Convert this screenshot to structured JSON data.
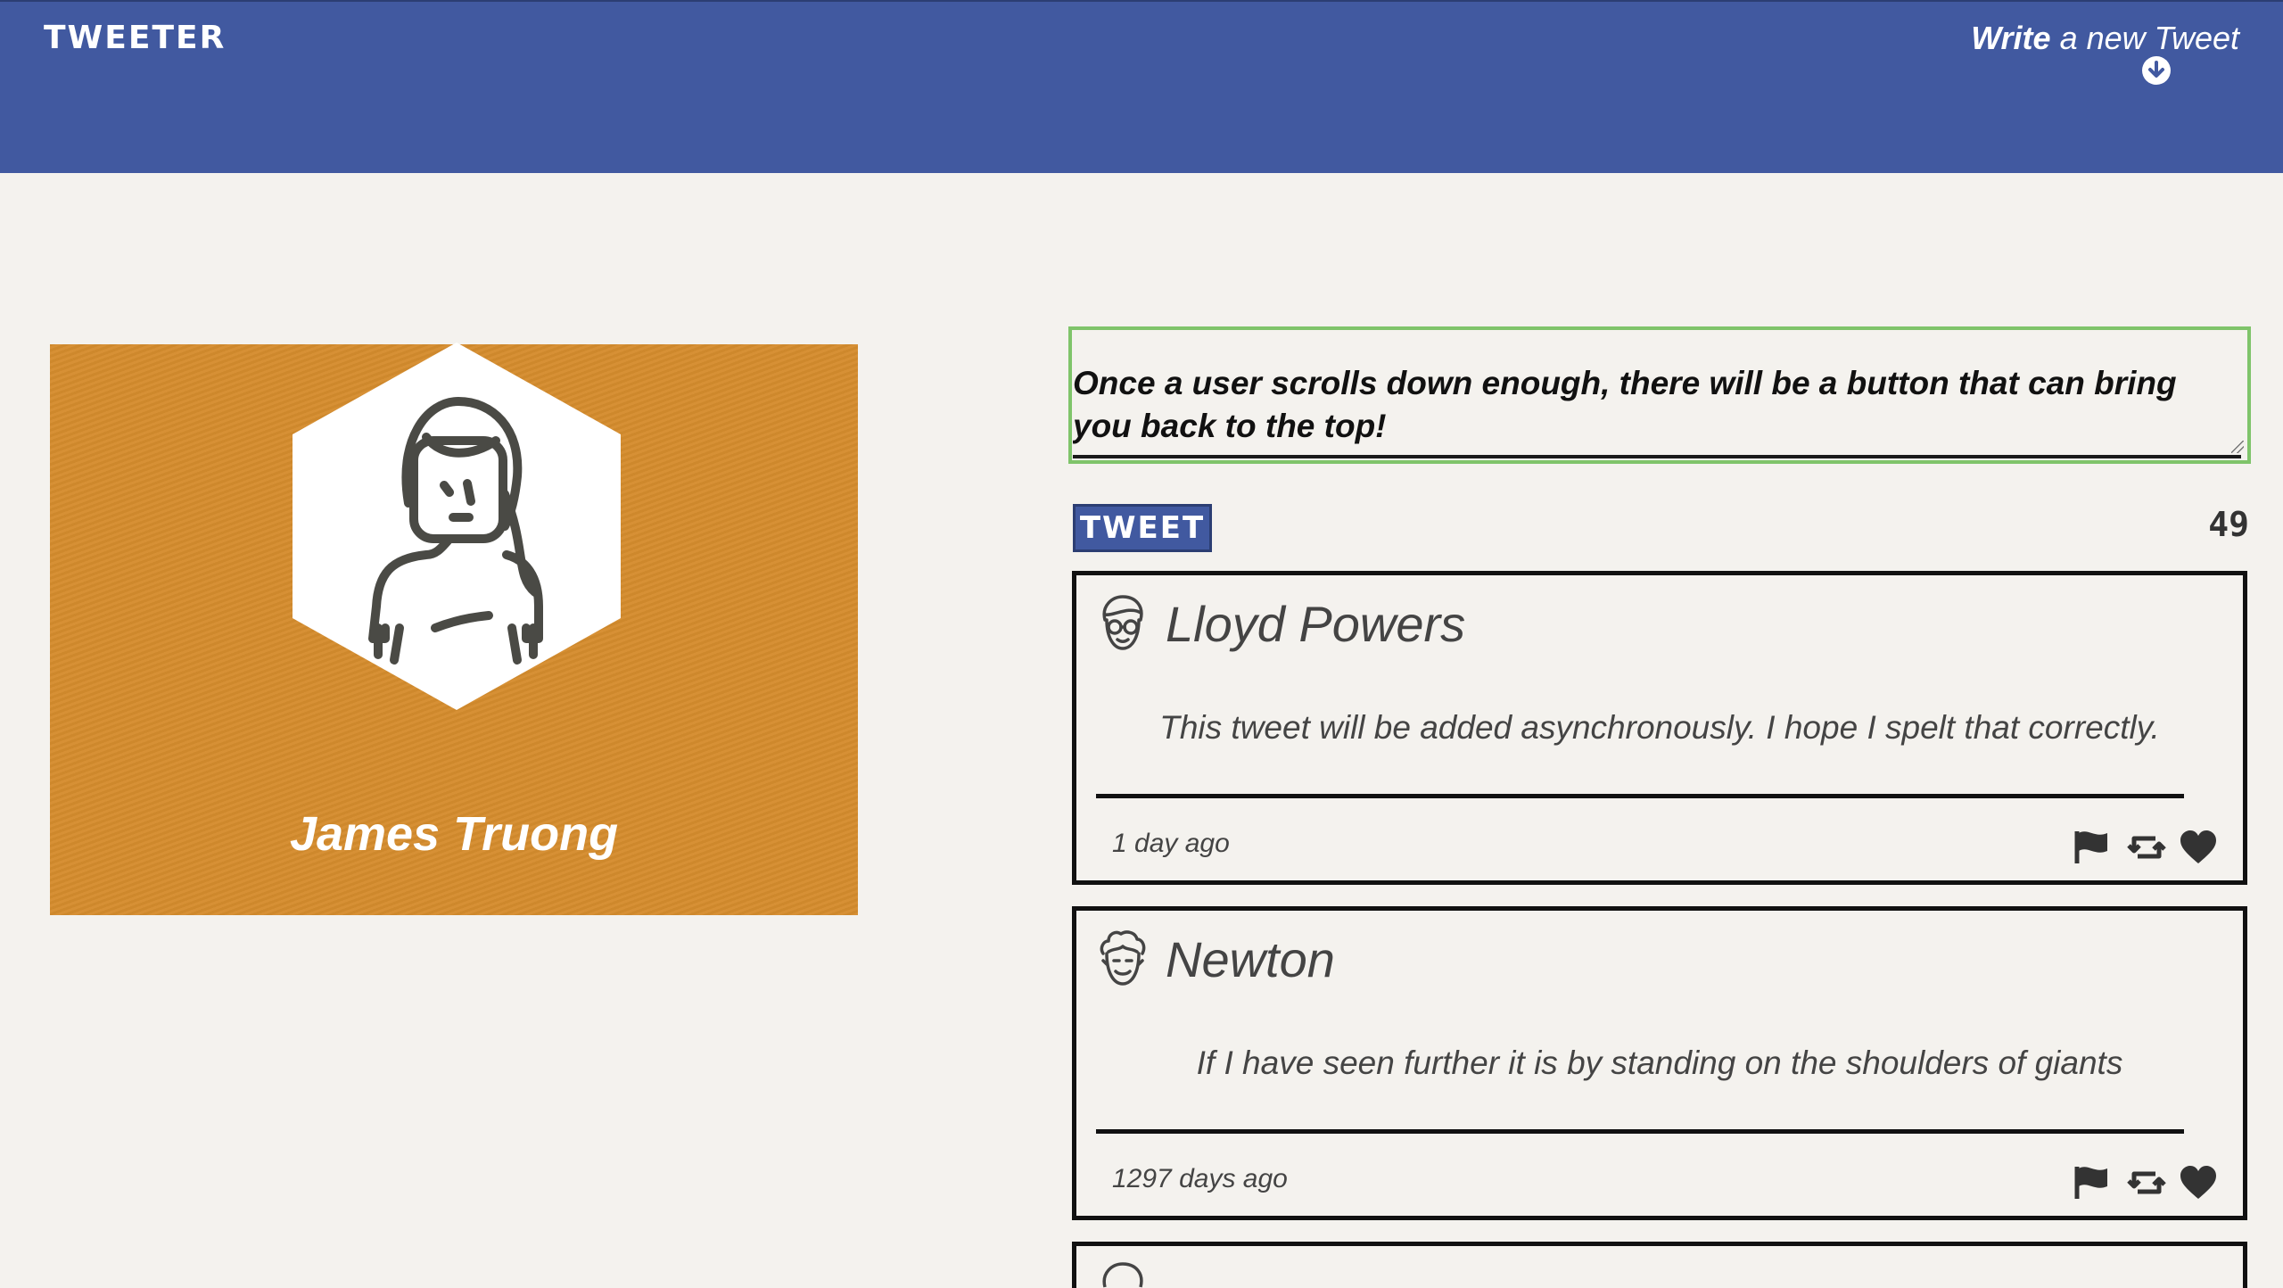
{
  "header": {
    "brand": "TWEETER",
    "compose_bold": "Write",
    "compose_light": "a new Tweet",
    "compose_icon": "arrow-down-circle-icon"
  },
  "profile": {
    "name": "James Truong",
    "avatar_icon": "woman-avatar-icon",
    "background_color": "#d58c2d"
  },
  "composer": {
    "value": "Once a user scrolls down enough, there will be a button that can bring you back to the top!",
    "submit_label": "TWEET",
    "counter": "49"
  },
  "tweets": [
    {
      "author": "Lloyd Powers",
      "avatar_icon": "glasses-man-avatar-icon",
      "content": "This tweet will be added asynchronously. I hope I spelt that correctly.",
      "timestamp": "1 day ago"
    },
    {
      "author": "Newton",
      "avatar_icon": "curly-hair-man-avatar-icon",
      "content": "If I have seen further it is by standing on the shoulders of giants",
      "timestamp": "1297 days ago"
    }
  ],
  "colors": {
    "nav": "#4159a0",
    "accent": "#7fc46a",
    "page": "#f4f2ee"
  }
}
